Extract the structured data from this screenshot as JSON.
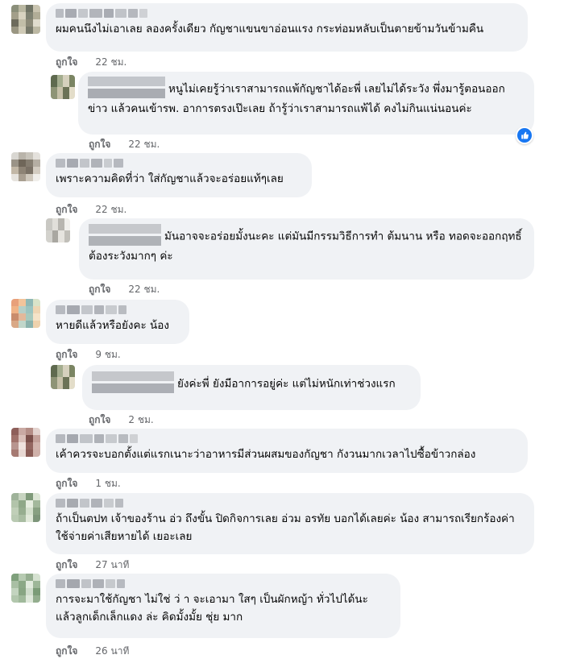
{
  "like_label": "ถูกใจ",
  "comments": [
    {
      "text": "ผมคนนึงไม่เอาเลย ลองครั้งเดียว กัญชาแขนขาอ่อนแรง กระท่อมหลับเป็นตายข้ามวันข้ามคืน",
      "time": "22 ชม.",
      "avatar_colors": [
        "#8b8f7a",
        "#b9b7a1",
        "#6f7364",
        "#c9c4b0",
        "#a39f8a",
        "#d8d3c0",
        "#7f8272",
        "#b1ad97",
        "#6d6b5c",
        "#c2bea8",
        "#8c8a78",
        "#e0dccd",
        "#9a9682",
        "#cfcab6",
        "#77796a",
        "#bdb9a4"
      ]
    },
    {
      "text": "หนูไม่เคยรู้ว่าเราสามารถแพ้กัญชาได้อะพี่ เลยไม่ได้ระวัง พึ่งมารู้ตอนออกข่าว แล้วคนเข้ารพ. อาการตรงเป๊ะเลย ถ้ารู้ว่าเราสามารถแพ้ได้ คงไม่กินแน่นอนค่ะ",
      "time": "22 ชม.",
      "avatar_colors": [
        "#5f6a4f",
        "#a4ad8f",
        "#d5d0bd",
        "#7b8563",
        "#8e9476",
        "#c6c0a8",
        "#6b7256",
        "#e3ddc9"
      ]
    },
    {
      "text": "เพราะความคิดที่ว่า ใส่กัญชาแล้วจะอร่อยแท้ๆเลย",
      "time": "22 ชม.",
      "avatar_colors": [
        "#d9d7d2",
        "#b9b4aa",
        "#c8c4bb",
        "#e4e1dc",
        "#9a9387",
        "#6f6659",
        "#857d70",
        "#b5aea3",
        "#c2b7a6",
        "#8d8375",
        "#7a7165",
        "#d3ccc1",
        "#e6e3de",
        "#a99f91",
        "#cfc8bc",
        "#f0eeea"
      ]
    },
    {
      "text": "มันอาจจะอร่อยมั้งนะคะ แต่มันมีกรรมวิธีการทำ ต้มนาน หรือ ทอดจะออกฤทธิ์ ต้องระวังมากๆ ค่ะ",
      "time": "22 ชม.",
      "avatar_colors": [
        "#c9c8c3",
        "#e1dfda",
        "#b7b5af",
        "#f0efeb",
        "#d3d2cd",
        "#a9a7a1",
        "#e6e4df",
        "#c1bfb9"
      ]
    },
    {
      "text": "หายดีแล้วหรือยังคะ น้อง",
      "time": "9 ชม.",
      "avatar_colors": [
        "#e8a07a",
        "#f2c49b",
        "#8fb8b5",
        "#d9e3c9",
        "#f0b386",
        "#b6cfc7",
        "#9bc4c0",
        "#eed6b4",
        "#c98c6c",
        "#e2b89a",
        "#a7c9bd",
        "#f5e3c8",
        "#d9a987",
        "#c1d6ca",
        "#8cb3ad",
        "#efd2ad"
      ]
    },
    {
      "text": "ยังค่ะพี่ ยังมีอาการอยู่ค่ะ แต่ไม่หนักเท่าช่วงแรก",
      "time": "2 ชม.",
      "avatar_colors": [
        "#5f6a4f",
        "#a4ad8f",
        "#d5d0bd",
        "#7b8563",
        "#8e9476",
        "#c6c0a8",
        "#6b7256",
        "#e3ddc9"
      ]
    },
    {
      "text": "เค้าควรจะบอกตั้งแต่แรกเนาะว่าอาหารมีส่วนผสมของกัญชา กังวนมากเวลาไปซื้อข้าวกล่อง",
      "time": "1 ชม.",
      "avatar_colors": [
        "#8e5f5a",
        "#c9a9a3",
        "#b48d86",
        "#e3d3cf",
        "#a0726b",
        "#d9bfb9",
        "#7b4f4a",
        "#c4a29b",
        "#b8958f",
        "#efe2de",
        "#936660",
        "#d2b5ae",
        "#a67a73",
        "#e8d8d3",
        "#8a5c56",
        "#cfb1aa"
      ]
    },
    {
      "text": "ถ้าเป็นตปท เจ้าของร้าน อ่ว ถึงขั้น ปิดกิจการเลย อ่วม อรทัย บอกได้เลยค่ะ น้อง สามารถเรียกร้องค่าใช้จ่ายค่าเสียหายได้ เยอะเลย",
      "time": "27 นาที",
      "avatar_colors": [
        "#9fb39a",
        "#c7d4c0",
        "#7f9a7a",
        "#dde6d6",
        "#b2c4aa",
        "#8fa888",
        "#e6ede0",
        "#a3b89c",
        "#c0cfb8",
        "#96ad8f",
        "#d4e0cd",
        "#88a082",
        "#b9cab2",
        "#a9bda2",
        "#e1e9da",
        "#7d957a"
      ]
    },
    {
      "text": "การจะมาใช้กัญชา ไม่ใช่ ว่ า จะเอามา ใสๆ เป็นผักหญ้า ทั่วไปได้นะ แล้วลูกเด็กเล็กแดง ล่ะ คิดมั้งมั้ย ชุ่ย มาก",
      "time": "26 นาที",
      "avatar_colors": [
        "#7fa07c",
        "#b6cab1",
        "#95ae90",
        "#d6e2d1",
        "#a9bfa4",
        "#8ba886",
        "#e1eadd",
        "#9db698",
        "#c3d4bf",
        "#88a583",
        "#cfdccb",
        "#7b9b77",
        "#b2c7ad",
        "#a0b99b",
        "#dfe8db",
        "#93ad8e"
      ]
    }
  ]
}
